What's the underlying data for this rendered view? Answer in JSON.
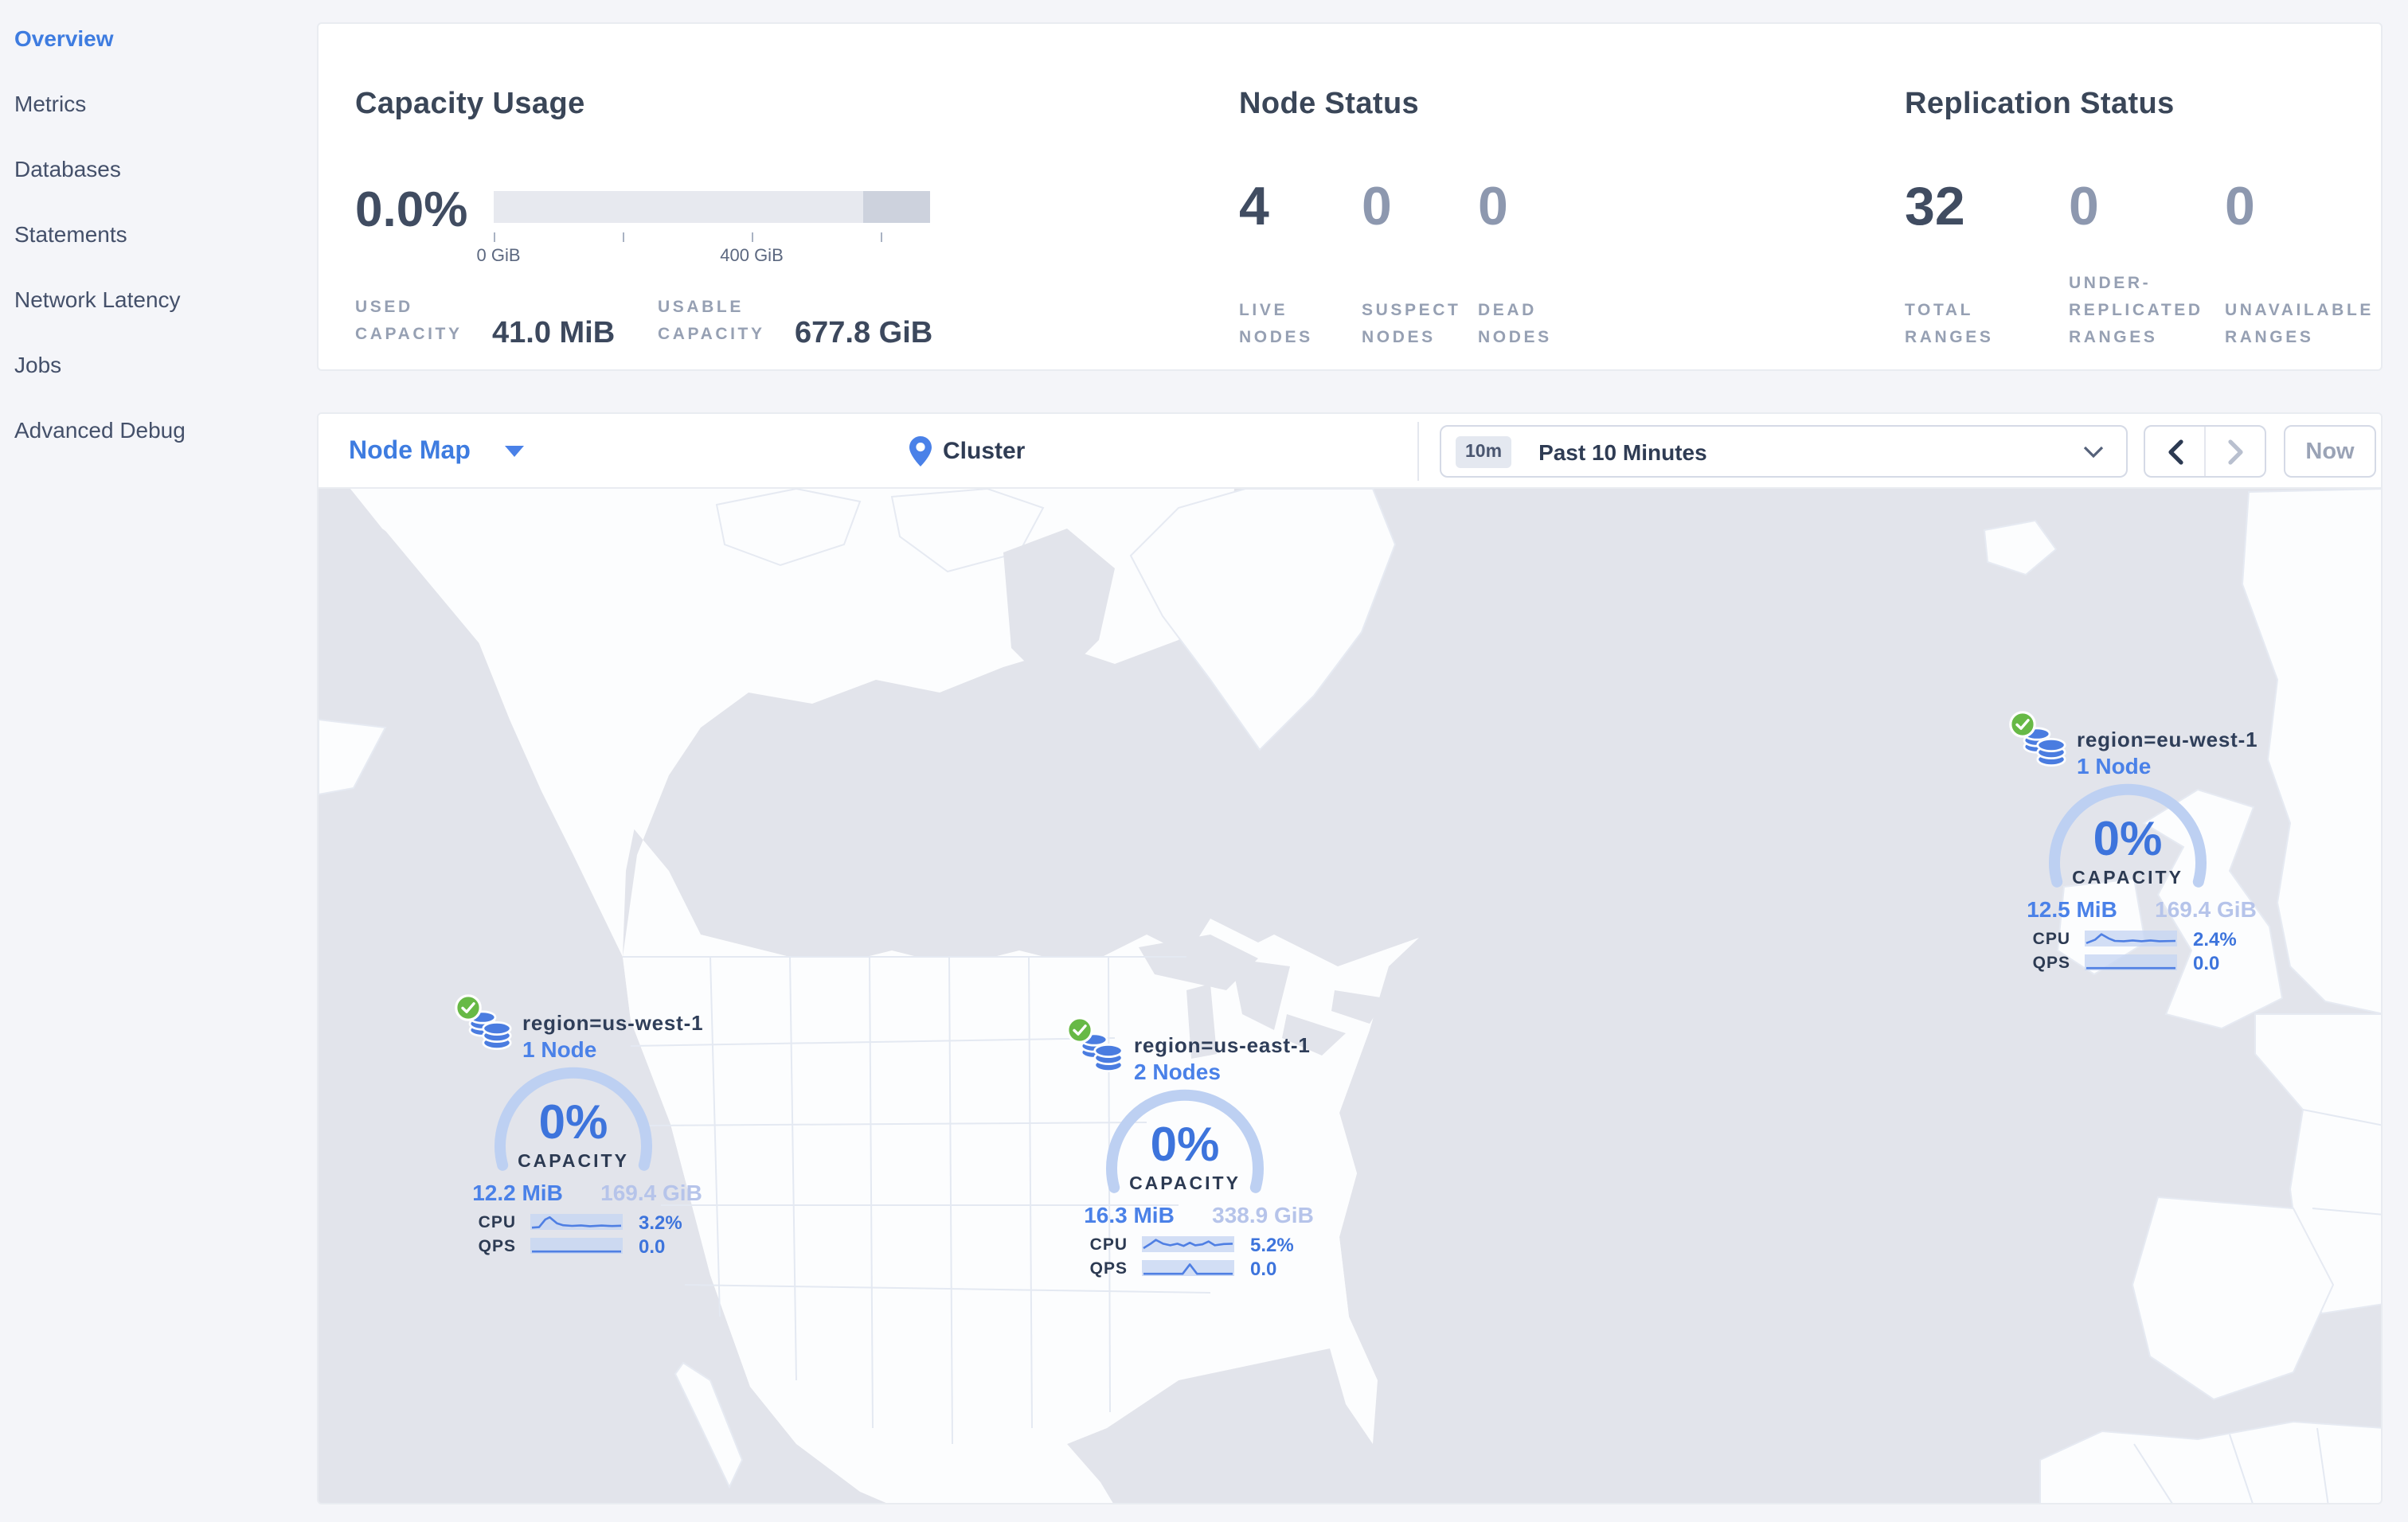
{
  "colors": {
    "accent_blue": "#3e7ce0",
    "marker_blue": "#4a81e8",
    "arc_light_blue": "#bdd0f2",
    "green_ok": "#67b946",
    "page_bg": "#f4f5f9",
    "ocean": "#e2e4eb",
    "land": "#fcfdfe"
  },
  "sidebar": {
    "items": [
      {
        "label": "Overview",
        "active": true
      },
      {
        "label": "Metrics",
        "active": false
      },
      {
        "label": "Databases",
        "active": false
      },
      {
        "label": "Statements",
        "active": false
      },
      {
        "label": "Network Latency",
        "active": false
      },
      {
        "label": "Jobs",
        "active": false
      },
      {
        "label": "Advanced Debug",
        "active": false
      }
    ]
  },
  "capacity": {
    "title": "Capacity Usage",
    "percent": "0.0%",
    "tick_label_0": "0 GiB",
    "tick_label_400": "400 GiB",
    "used_label": "USED CAPACITY",
    "used_value": "41.0 MiB",
    "usable_label": "USABLE CAPACITY",
    "usable_value": "677.8 GiB"
  },
  "node_status": {
    "title": "Node Status",
    "stats": [
      {
        "value": "4",
        "label": "LIVE NODES"
      },
      {
        "value": "0",
        "label": "SUSPECT NODES"
      },
      {
        "value": "0",
        "label": "DEAD NODES"
      }
    ]
  },
  "replication": {
    "title": "Replication Status",
    "stats": [
      {
        "value": "32",
        "label": "TOTAL RANGES"
      },
      {
        "value": "0",
        "label": "UNDER-REPLICATED RANGES"
      },
      {
        "value": "0",
        "label": "UNAVAILABLE RANGES"
      }
    ]
  },
  "toolbar": {
    "view_selector": "Node Map",
    "breadcrumb": "Cluster",
    "range_badge": "10m",
    "range_label": "Past 10 Minutes",
    "back_arrow": "chevron-left",
    "forward_arrow": "chevron-right",
    "now_label": "Now"
  },
  "map_markers": [
    {
      "region": "region=us-west-1",
      "nodes": "1 Node",
      "percent": "0%",
      "capacity_label": "CAPACITY",
      "used": "12.2 MiB",
      "total": "169.4 GiB",
      "cpu_label": "CPU",
      "cpu_value": "3.2%",
      "qps_label": "QPS",
      "qps_value": "0.0",
      "cpu_points": [
        [
          0,
          0.06
        ],
        [
          0.08,
          0.1
        ],
        [
          0.15,
          0.7
        ],
        [
          0.2,
          0.88
        ],
        [
          0.28,
          0.4
        ],
        [
          0.35,
          0.25
        ],
        [
          0.45,
          0.2
        ],
        [
          0.55,
          0.24
        ],
        [
          0.65,
          0.18
        ],
        [
          0.78,
          0.23
        ],
        [
          0.9,
          0.19
        ],
        [
          1,
          0.21
        ]
      ],
      "qps_points": [
        [
          0,
          0.06
        ],
        [
          1,
          0.06
        ]
      ]
    },
    {
      "region": "region=us-east-1",
      "nodes": "2 Nodes",
      "percent": "0%",
      "capacity_label": "CAPACITY",
      "used": "16.3 MiB",
      "total": "338.9 GiB",
      "cpu_label": "CPU",
      "cpu_value": "5.2%",
      "qps_label": "QPS",
      "qps_value": "0.0",
      "cpu_points": [
        [
          0,
          0.2
        ],
        [
          0.08,
          0.55
        ],
        [
          0.14,
          0.85
        ],
        [
          0.22,
          0.55
        ],
        [
          0.3,
          0.42
        ],
        [
          0.38,
          0.55
        ],
        [
          0.45,
          0.38
        ],
        [
          0.52,
          0.62
        ],
        [
          0.58,
          0.42
        ],
        [
          0.66,
          0.5
        ],
        [
          0.73,
          0.72
        ],
        [
          0.8,
          0.42
        ],
        [
          0.9,
          0.52
        ],
        [
          1,
          0.55
        ]
      ],
      "qps_points": [
        [
          0,
          0.06
        ],
        [
          0.44,
          0.06
        ],
        [
          0.52,
          0.8
        ],
        [
          0.6,
          0.06
        ],
        [
          1,
          0.06
        ]
      ]
    },
    {
      "region": "region=eu-west-1",
      "nodes": "1 Node",
      "percent": "0%",
      "capacity_label": "CAPACITY",
      "used": "12.5 MiB",
      "total": "169.4 GiB",
      "cpu_label": "CPU",
      "cpu_value": "2.4%",
      "qps_label": "QPS",
      "qps_value": "0.0",
      "cpu_points": [
        [
          0,
          0.15
        ],
        [
          0.1,
          0.42
        ],
        [
          0.17,
          0.85
        ],
        [
          0.25,
          0.52
        ],
        [
          0.32,
          0.33
        ],
        [
          0.42,
          0.3
        ],
        [
          0.52,
          0.36
        ],
        [
          0.62,
          0.3
        ],
        [
          0.72,
          0.36
        ],
        [
          0.82,
          0.3
        ],
        [
          1,
          0.33
        ]
      ],
      "qps_points": [
        [
          0,
          0.06
        ],
        [
          1,
          0.06
        ]
      ]
    }
  ]
}
